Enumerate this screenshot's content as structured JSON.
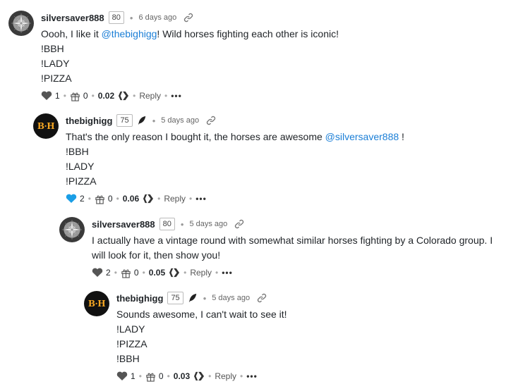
{
  "comments": [
    {
      "author": "silversaver888",
      "reputation": "80",
      "time": "6 days ago",
      "lines": [
        {
          "pre": "Oooh, I like it ",
          "mention": "@thebighigg",
          "post": "! Wild horses fighting each other is iconic!"
        },
        {
          "pre": "!BBH",
          "mention": "",
          "post": ""
        },
        {
          "pre": "!LADY",
          "mention": "",
          "post": ""
        },
        {
          "pre": "!PIZZA",
          "mention": "",
          "post": ""
        }
      ],
      "votes": "1",
      "gifts": "0",
      "payout": "0.02",
      "reply_label": "Reply",
      "more_label": "•••",
      "avatar_icon": "silver-coin-avatar",
      "vote_color": "#555555"
    },
    {
      "author": "thebighigg",
      "reputation": "75",
      "time": "5 days ago",
      "lines": [
        {
          "pre": "That's the only reason I bought it, the horses are awesome ",
          "mention": "@silversaver888",
          "post": " !"
        },
        {
          "pre": "!BBH",
          "mention": "",
          "post": ""
        },
        {
          "pre": "!LADY",
          "mention": "",
          "post": ""
        },
        {
          "pre": "!PIZZA",
          "mention": "",
          "post": ""
        }
      ],
      "votes": "2",
      "gifts": "0",
      "payout": "0.06",
      "reply_label": "Reply",
      "more_label": "•••",
      "avatar_text": "B·H",
      "vote_color": "#1a9ee6"
    },
    {
      "author": "silversaver888",
      "reputation": "80",
      "time": "5 days ago",
      "lines": [
        {
          "pre": "I actually have a vintage round with somewhat similar horses fighting by a Colorado group. I",
          "mention": "",
          "post": ""
        },
        {
          "pre": "will look for it, then show you!",
          "mention": "",
          "post": ""
        }
      ],
      "votes": "2",
      "gifts": "0",
      "payout": "0.05",
      "reply_label": "Reply",
      "more_label": "•••",
      "avatar_icon": "silver-coin-avatar",
      "vote_color": "#555555"
    },
    {
      "author": "thebighigg",
      "reputation": "75",
      "time": "5 days ago",
      "lines": [
        {
          "pre": "Sounds awesome, I can't wait to see it!",
          "mention": "",
          "post": ""
        },
        {
          "pre": "!LADY",
          "mention": "",
          "post": ""
        },
        {
          "pre": "!PIZZA",
          "mention": "",
          "post": ""
        },
        {
          "pre": "!BBH",
          "mention": "",
          "post": ""
        }
      ],
      "votes": "1",
      "gifts": "0",
      "payout": "0.03",
      "reply_label": "Reply",
      "more_label": "•••",
      "avatar_text": "B·H",
      "vote_color": "#555555"
    }
  ]
}
